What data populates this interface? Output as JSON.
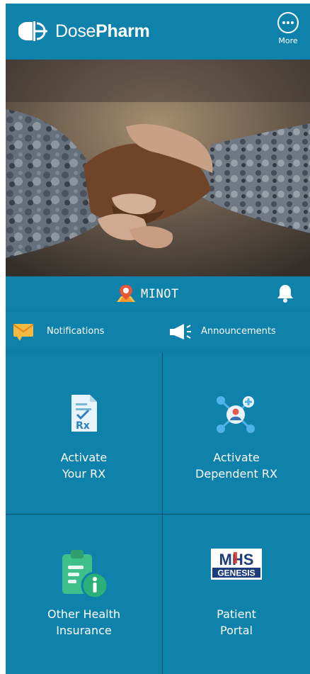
{
  "header": {
    "brand_part1": "Dose",
    "brand_part2": "Pharm",
    "more_label": "More"
  },
  "hero": {
    "icon": "handshake-photo"
  },
  "location": {
    "name": "MINOT",
    "pin_icon": "location-pin-icon",
    "bell_icon": "bell-icon"
  },
  "quick_links": {
    "notifications": "Notifications",
    "announcements": "Announcements"
  },
  "tiles": [
    {
      "label": "Activate\nYour RX",
      "icon": "prescription-document-icon"
    },
    {
      "label": "Activate\nDependent RX",
      "icon": "dependent-network-icon"
    },
    {
      "label": "Other Health\nInsurance",
      "icon": "clipboard-info-icon"
    },
    {
      "label": "Patient\nPortal",
      "icon": "mhs-genesis-logo"
    }
  ],
  "mhs_logo": {
    "line1": "MHS",
    "line2": "GENESIS"
  },
  "colors": {
    "primary": "#0e82aa",
    "divider": "#0b4f6a",
    "accent_orange": "#f5a623"
  }
}
